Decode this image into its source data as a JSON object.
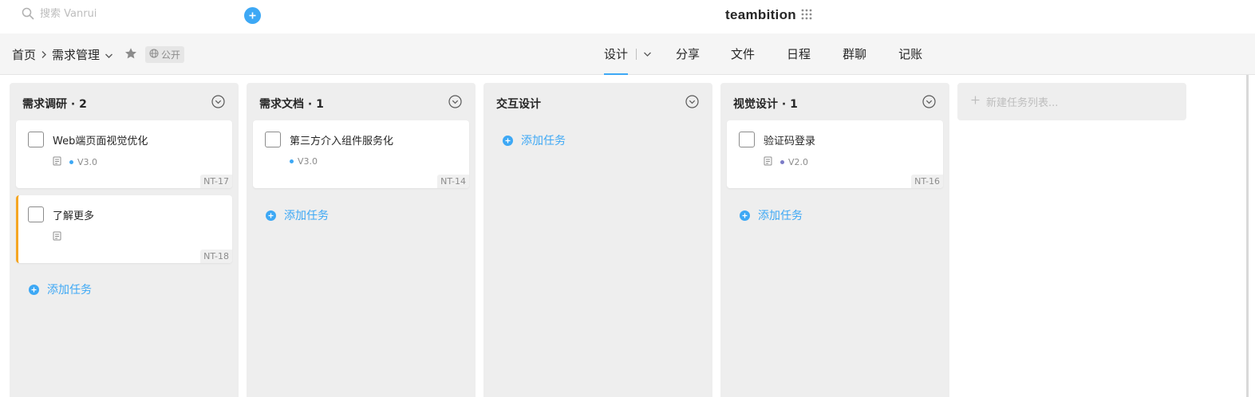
{
  "search": {
    "placeholder": "搜索 Vanrui"
  },
  "brand": {
    "name": "teambition",
    "accent": "#3da8f5"
  },
  "breadcrumb": {
    "home": "首页",
    "project": "需求管理"
  },
  "visibility": {
    "label": "公开"
  },
  "nav": {
    "tabs": [
      "设计",
      "分享",
      "文件",
      "日程",
      "群聊",
      "记账"
    ],
    "active": "设计"
  },
  "columns": [
    {
      "title": "需求调研 · 2",
      "cards": [
        {
          "title": "Web端页面视觉优化",
          "version": "V3.0",
          "dot_color": "#3da8f5",
          "code": "NT-17",
          "has_note": true,
          "priority": false
        },
        {
          "title": "了解更多",
          "version": "",
          "dot_color": "",
          "code": "NT-18",
          "has_note": true,
          "priority": true
        }
      ],
      "add_label": "添加任务"
    },
    {
      "title": "需求文档 · 1",
      "cards": [
        {
          "title": "第三方介入组件服务化",
          "version": "V3.0",
          "dot_color": "#3da8f5",
          "code": "NT-14",
          "has_note": false,
          "priority": false
        }
      ],
      "add_label": "添加任务"
    },
    {
      "title": "交互设计",
      "cards": [],
      "add_label": "添加任务"
    },
    {
      "title": "视觉设计 · 1",
      "cards": [
        {
          "title": "验证码登录",
          "version": "V2.0",
          "dot_color": "#7b7bc7",
          "code": "NT-16",
          "has_note": true,
          "priority": false
        }
      ],
      "add_label": "添加任务"
    }
  ],
  "new_list": {
    "label": "新建任务列表..."
  }
}
